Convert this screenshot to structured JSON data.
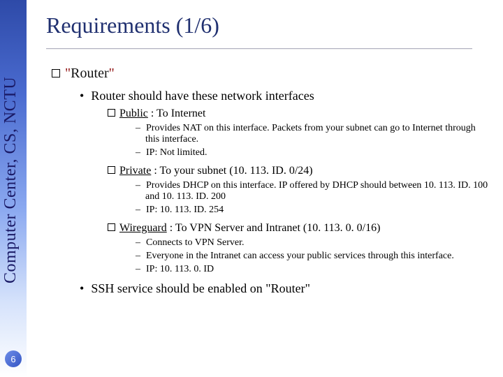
{
  "sidebar": {
    "label": "Computer Center, CS, NCTU",
    "page_number": "6"
  },
  "title": "Requirements (1/6)",
  "router": {
    "quote_open": "\"",
    "word": "Router",
    "quote_close": "\"",
    "intro": "Router should have these network interfaces",
    "public": {
      "label": "Public",
      "desc": " : To Internet",
      "d1": "Provides NAT on this interface. Packets from your subnet can go to Internet through this interface.",
      "d2": "IP: Not limited."
    },
    "private": {
      "label": "Private",
      "desc": " : To your subnet (10. 113. ID. 0/24)",
      "d1": "Provides DHCP on this interface. IP offered by DHCP should between 10. 113. ID. 100 and 10. 113. ID. 200",
      "d2": "IP: 10. 113. ID. 254"
    },
    "wireguard": {
      "label": "Wireguard",
      "desc": " : To VPN Server and Intranet (10. 113. 0. 0/16)",
      "d1": "Connects to VPN Server.",
      "d2": "Everyone in the Intranet can access your public services through this interface.",
      "d3": "IP: 10. 113. 0. ID"
    },
    "ssh": "SSH service should be enabled on \"Router\""
  }
}
